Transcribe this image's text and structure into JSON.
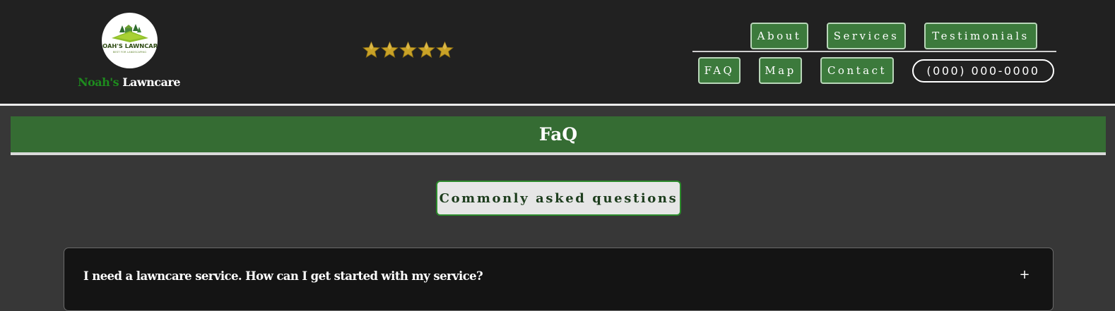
{
  "header": {
    "logo_text": "NOAH'S LAWNCARE",
    "logo_tagline": "BEST FOR LANDSCAPING",
    "brand_green": "Noah's",
    "brand_white": "Lawncare",
    "rating_stars": 5
  },
  "nav": {
    "row1": [
      "About",
      "Services",
      "Testimonials"
    ],
    "row2": [
      "FAQ",
      "Map",
      "Contact"
    ],
    "phone": "(000) 000-0000"
  },
  "main": {
    "title": "FaQ",
    "subtitle": "Commonly asked questions",
    "faq_items": [
      {
        "question": "I need a lawncare service. How can I get started with my service?",
        "toggle": "+"
      }
    ]
  },
  "colors": {
    "header_bg": "#212121",
    "page_bg": "#373737",
    "accent_green": "#356c33",
    "button_green": "#3c7a3c",
    "brand_green": "#1e8a1e",
    "star_gold": "#c9a227"
  },
  "icons": {
    "logo": "lawncare-logo-icon",
    "star": "star-icon",
    "toggle": "plus-icon"
  }
}
